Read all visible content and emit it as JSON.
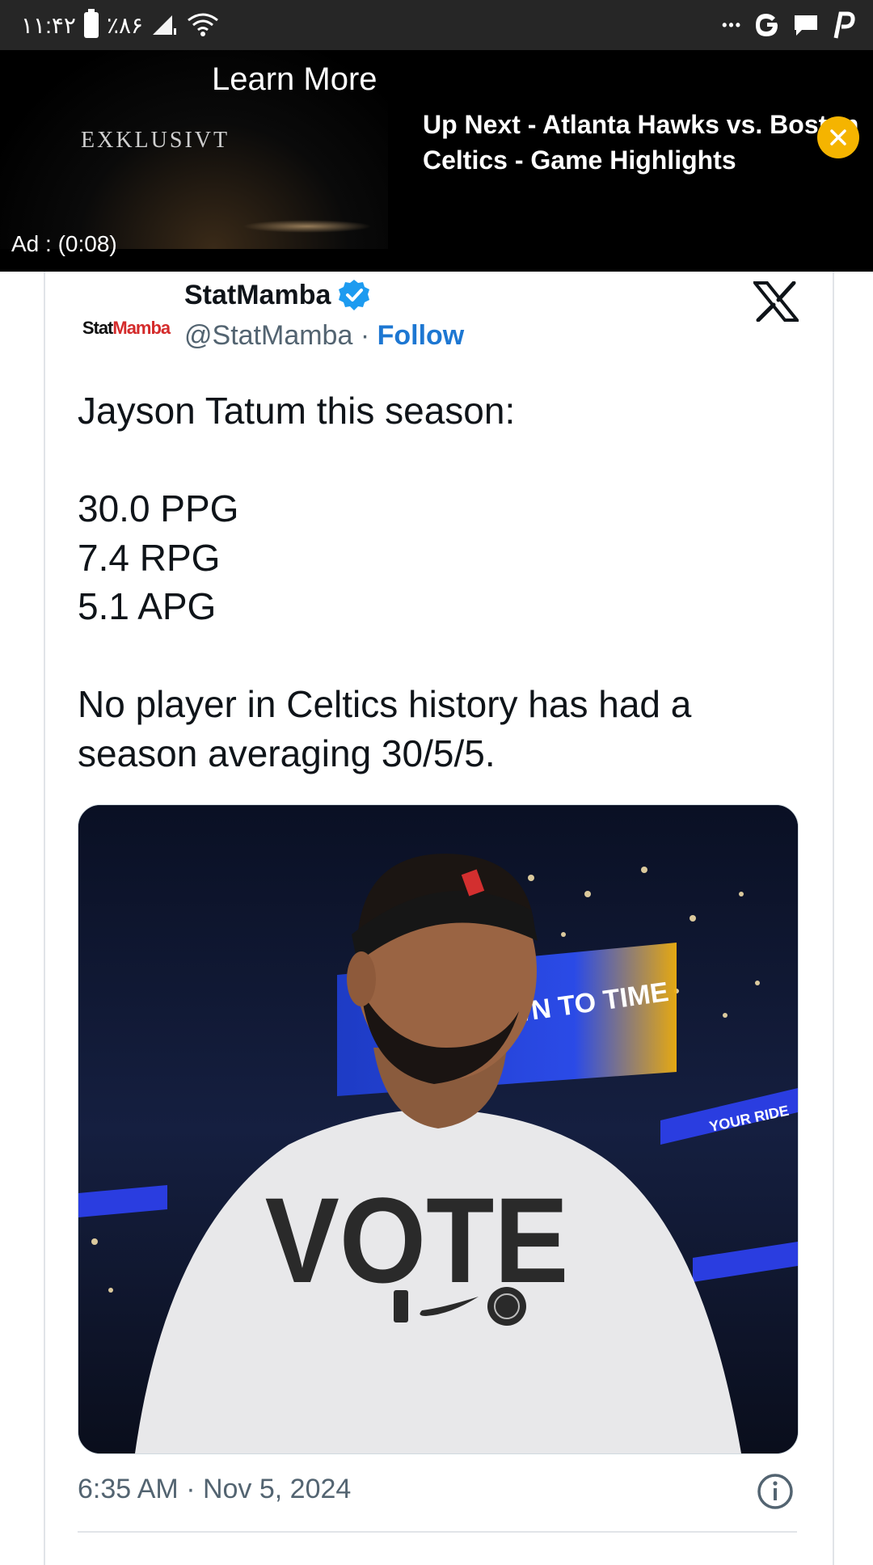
{
  "status_bar": {
    "time": "۱۱:۴۲",
    "battery_percent": "٪۸۶",
    "overflow": "•••",
    "notification_icons": [
      "google-icon",
      "chat-icon",
      "pinterest-icon"
    ]
  },
  "ad": {
    "learn_more": "Learn More",
    "brand_text": "EXKLUSIVT",
    "timer": "Ad : (0:08)",
    "up_next": "Up Next - Atlanta Hawks vs. Boston Celtics - Game Highlights",
    "close_icon": "close-icon",
    "accent_color": "#f5b400"
  },
  "tweet": {
    "avatar_text": {
      "part1": "Stat",
      "part2": "Mamba"
    },
    "author_name": "StatMamba",
    "handle": "@StatMamba",
    "separator": "·",
    "follow_label": "Follow",
    "text": "Jayson Tatum this season:\n\n30.0 PPG\n7.4 RPG\n5.1 APG\n\nNo player in Celtics history has had a season averaging 30/5/5.",
    "image": {
      "shirt_text": "VOTE",
      "arena_sign": "WN TO TIME",
      "ribbon_text": "YOUR RIDE"
    },
    "timestamp": "6:35 AM · Nov 5, 2024",
    "accent_color": "#1d77d2"
  }
}
